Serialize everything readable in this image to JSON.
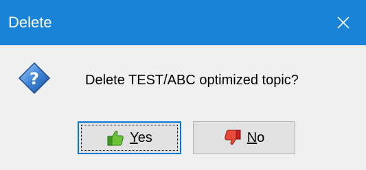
{
  "window": {
    "title": "Delete",
    "titlebar_color": "#1883d7"
  },
  "icons": {
    "close": "close-icon",
    "question": "question-icon",
    "yes": "thumbs-up-icon",
    "no": "thumbs-down-icon"
  },
  "dialog": {
    "message": "Delete TEST/ABC optimized topic?"
  },
  "buttons": {
    "yes": {
      "mnemonic": "Y",
      "rest": "es"
    },
    "no": {
      "mnemonic": "N",
      "rest": "o"
    }
  }
}
